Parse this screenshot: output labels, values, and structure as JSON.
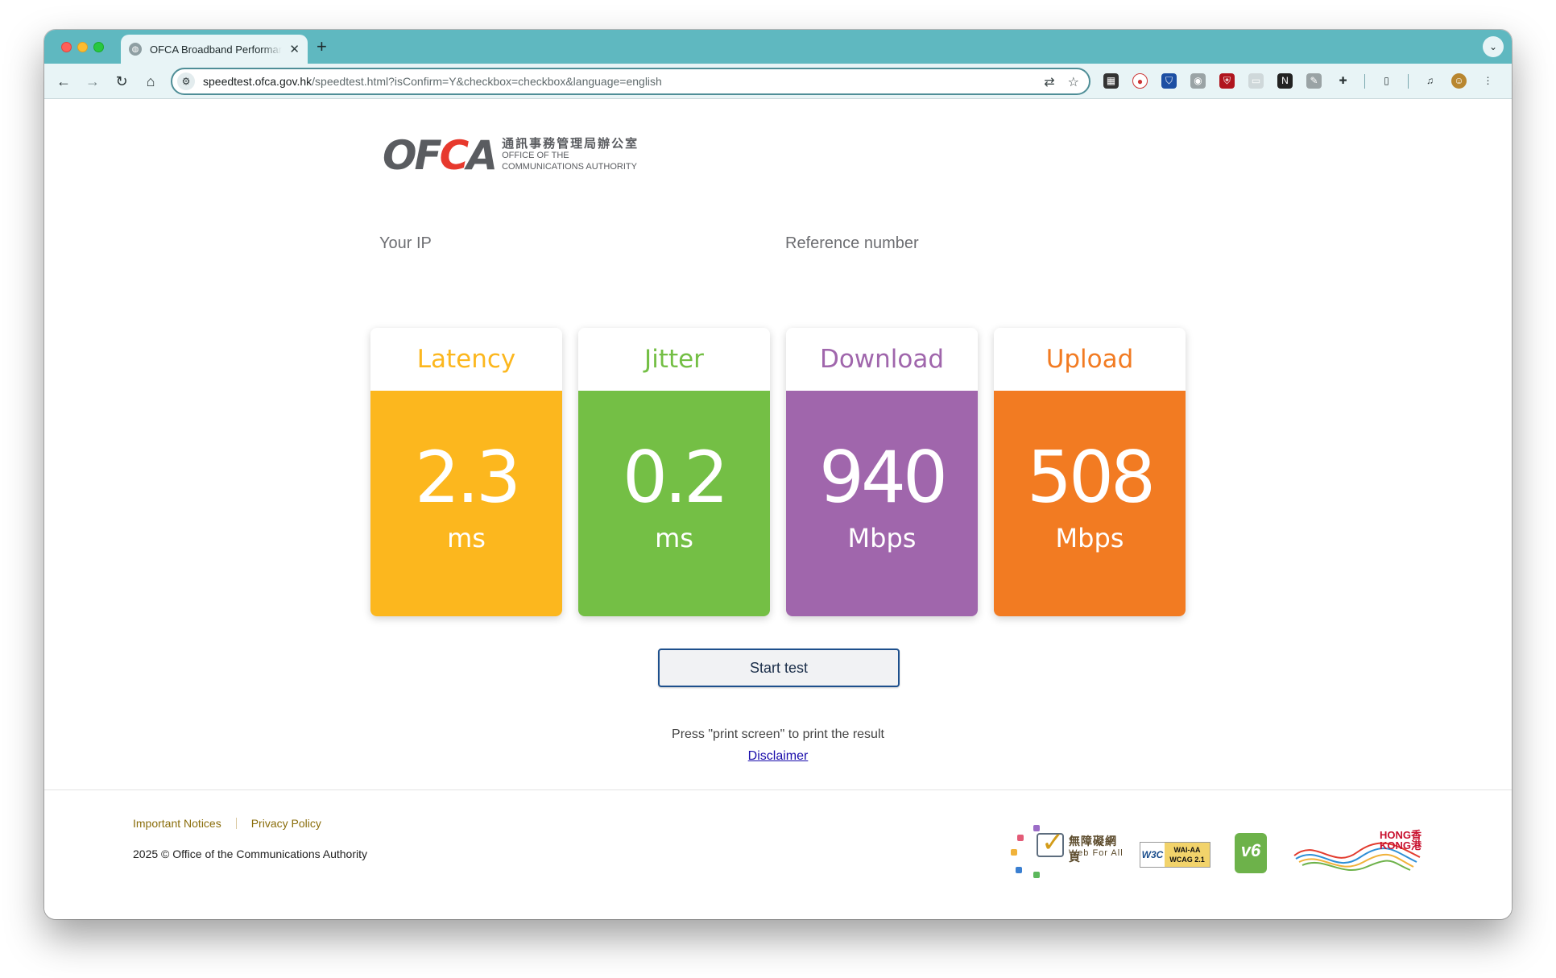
{
  "browser": {
    "tab_title": "OFCA Broadband Performance",
    "url_host": "speedtest.ofca.gov.hk",
    "url_path": "/speedtest.html?isConfirm=Y&checkbox=checkbox&language=english",
    "new_tab_symbol": "+",
    "close_symbol": "✕"
  },
  "logo": {
    "mark_prefix": "OF",
    "mark_c": "C",
    "mark_suffix": "A",
    "zh_name": "通訊事務管理局辦公室",
    "en_line1": "OFFICE OF THE",
    "en_line2": "COMMUNICATIONS AUTHORITY"
  },
  "meta": {
    "ip_label": "Your IP",
    "ref_label": "Reference number"
  },
  "metrics": {
    "latency": {
      "title": "Latency",
      "value": "2.3",
      "unit": "ms",
      "color": "#fcb71e"
    },
    "jitter": {
      "title": "Jitter",
      "value": "0.2",
      "unit": "ms",
      "color": "#74bf45"
    },
    "download": {
      "title": "Download",
      "value": "940",
      "unit": "Mbps",
      "color": "#a066ac"
    },
    "upload": {
      "title": "Upload",
      "value": "508",
      "unit": "Mbps",
      "color": "#f27b22"
    }
  },
  "actions": {
    "start_test": "Start test",
    "print_note": "Press \"print screen\" to print the result",
    "disclaimer": "Disclaimer"
  },
  "footer": {
    "important_notices": "Important Notices",
    "privacy_policy": "Privacy Policy",
    "copyright": "2025 © Office of the Communications Authority",
    "wfa_zh": "無障礙網頁",
    "wfa_en": "Web For All",
    "w3c_left": "W3C",
    "w3c_line1": "WAI-AA",
    "w3c_line2": "WCAG 2.1",
    "ipv6_text": "v6",
    "brandhk_line1": "HONG香",
    "brandhk_line2": "KONG港"
  }
}
